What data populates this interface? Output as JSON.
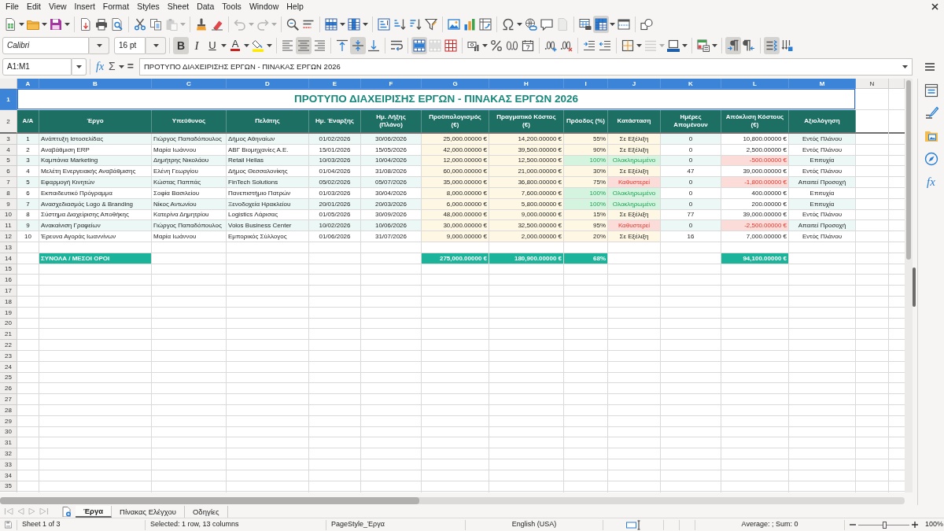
{
  "menu": [
    "File",
    "Edit",
    "View",
    "Insert",
    "Format",
    "Styles",
    "Sheet",
    "Data",
    "Tools",
    "Window",
    "Help"
  ],
  "toolbar_1": [
    [
      {
        "kind": "new",
        "dropdown": true,
        "on": false,
        "disabled": false
      },
      {
        "kind": "open",
        "dropdown": true,
        "on": false,
        "disabled": false
      },
      {
        "kind": "save",
        "dropdown": true,
        "on": false,
        "disabled": false
      }
    ],
    [
      {
        "kind": "pdf",
        "dropdown": false,
        "on": false,
        "disabled": false
      },
      {
        "kind": "print",
        "dropdown": false,
        "on": false,
        "disabled": false
      },
      {
        "kind": "preview",
        "dropdown": false,
        "on": false,
        "disabled": false
      }
    ],
    [
      {
        "kind": "cut",
        "dropdown": false,
        "on": false,
        "disabled": false
      },
      {
        "kind": "copy",
        "dropdown": false,
        "on": false,
        "disabled": false
      },
      {
        "kind": "paste",
        "dropdown": true,
        "on": false,
        "disabled": true
      }
    ],
    [
      {
        "kind": "clone",
        "dropdown": false,
        "on": false,
        "disabled": false
      },
      {
        "kind": "clear",
        "dropdown": false,
        "on": false,
        "disabled": false
      }
    ],
    [
      {
        "kind": "undo",
        "dropdown": true,
        "on": false,
        "disabled": true
      },
      {
        "kind": "redo",
        "dropdown": true,
        "on": false,
        "disabled": true
      }
    ],
    [
      {
        "kind": "find",
        "dropdown": false,
        "on": false,
        "disabled": false
      },
      {
        "kind": "spelling",
        "dropdown": false,
        "on": false,
        "disabled": false
      }
    ],
    [
      {
        "kind": "rows",
        "dropdown": true,
        "on": false,
        "disabled": false
      },
      {
        "kind": "columns",
        "dropdown": true,
        "on": false,
        "disabled": false
      }
    ],
    [
      {
        "kind": "sort",
        "dropdown": false,
        "on": false,
        "disabled": false
      },
      {
        "kind": "sort_asc",
        "dropdown": false,
        "on": false,
        "disabled": false
      },
      {
        "kind": "sort_desc",
        "dropdown": false,
        "on": false,
        "disabled": false
      },
      {
        "kind": "filter",
        "dropdown": false,
        "on": false,
        "disabled": false
      }
    ],
    [
      {
        "kind": "image",
        "dropdown": false,
        "on": false,
        "disabled": false
      },
      {
        "kind": "chart",
        "dropdown": false,
        "on": false,
        "disabled": false
      },
      {
        "kind": "pivot",
        "dropdown": false,
        "on": false,
        "disabled": false
      }
    ],
    [
      {
        "kind": "special",
        "dropdown": true,
        "on": false,
        "disabled": false
      },
      {
        "kind": "hyperlink",
        "dropdown": false,
        "on": false,
        "disabled": false
      },
      {
        "kind": "comment",
        "dropdown": false,
        "on": false,
        "disabled": false
      },
      {
        "kind": "header_footer",
        "dropdown": false,
        "on": false,
        "disabled": true
      }
    ],
    [
      {
        "kind": "print_area",
        "dropdown": false,
        "on": false,
        "disabled": false
      },
      {
        "kind": "freeze",
        "dropdown": true,
        "on": true,
        "disabled": false
      },
      {
        "kind": "split",
        "dropdown": false,
        "on": false,
        "disabled": false
      }
    ],
    [
      {
        "kind": "draw",
        "dropdown": false,
        "on": false,
        "disabled": false
      }
    ]
  ],
  "font": {
    "name": "Calibri",
    "size": "16 pt"
  },
  "toolbar_2": [
    [
      {
        "kind": "bold",
        "glyph": "B",
        "dropdown": false,
        "on": true,
        "disabled": false
      },
      {
        "kind": "italic",
        "glyph": "I",
        "dropdown": false,
        "on": false,
        "disabled": false
      },
      {
        "kind": "underline",
        "glyph": "U",
        "dropdown": true,
        "on": false,
        "disabled": false
      },
      {
        "kind": "font_color",
        "glyph": "A",
        "dropdown": true,
        "on": false,
        "disabled": false
      },
      {
        "kind": "highlight",
        "dropdown": true,
        "on": false,
        "disabled": false
      }
    ],
    [
      {
        "kind": "align_left",
        "dropdown": false,
        "on": false,
        "disabled": false
      },
      {
        "kind": "align_center",
        "dropdown": false,
        "on": true,
        "disabled": false
      },
      {
        "kind": "align_right",
        "dropdown": false,
        "on": false,
        "disabled": false
      }
    ],
    [
      {
        "kind": "align_top",
        "dropdown": false,
        "on": false,
        "disabled": false
      },
      {
        "kind": "align_middle",
        "dropdown": false,
        "on": true,
        "disabled": false
      },
      {
        "kind": "align_bottom",
        "dropdown": false,
        "on": false,
        "disabled": false
      }
    ],
    [
      {
        "kind": "wrap",
        "dropdown": false,
        "on": false,
        "disabled": false
      }
    ],
    [
      {
        "kind": "merge_center",
        "dropdown": false,
        "on": true,
        "disabled": false
      },
      {
        "kind": "merge",
        "dropdown": false,
        "on": false,
        "disabled": true
      },
      {
        "kind": "unmerge",
        "dropdown": false,
        "on": false,
        "disabled": false
      }
    ],
    [
      {
        "kind": "currency",
        "dropdown": true,
        "on": false,
        "disabled": false
      },
      {
        "kind": "percent",
        "dropdown": false,
        "on": false,
        "disabled": false
      },
      {
        "kind": "number",
        "dropdown": false,
        "on": false,
        "disabled": false
      },
      {
        "kind": "date",
        "dropdown": false,
        "on": false,
        "disabled": false
      }
    ],
    [
      {
        "kind": "add_decimal",
        "dropdown": false,
        "on": false,
        "disabled": false
      },
      {
        "kind": "delete_decimal",
        "dropdown": false,
        "on": false,
        "disabled": false
      }
    ],
    [
      {
        "kind": "indent_more",
        "dropdown": false,
        "on": false,
        "disabled": false
      },
      {
        "kind": "indent_less",
        "dropdown": false,
        "on": false,
        "disabled": false
      }
    ],
    [
      {
        "kind": "borders",
        "dropdown": true,
        "on": false,
        "disabled": false
      },
      {
        "kind": "border_style",
        "dropdown": true,
        "on": false,
        "disabled": true
      },
      {
        "kind": "border_color",
        "dropdown": true,
        "on": false,
        "disabled": false
      }
    ],
    [
      {
        "kind": "conditional",
        "dropdown": true,
        "on": false,
        "disabled": false
      }
    ],
    [
      {
        "kind": "ltr",
        "dropdown": false,
        "on": true,
        "disabled": false
      },
      {
        "kind": "rtl",
        "dropdown": false,
        "on": false,
        "disabled": false
      }
    ],
    [
      {
        "kind": "text_ltr",
        "dropdown": false,
        "on": true,
        "disabled": false
      },
      {
        "kind": "text_ttb",
        "dropdown": false,
        "on": false,
        "disabled": false
      }
    ]
  ],
  "formula_bar": {
    "name_box": "A1:M1",
    "function_wizard": "fx",
    "sum": "Σ",
    "formula": "=",
    "content": "ΠΡΟΤΥΠΟ ΔΙΑΧΕΙΡΙΣΗΣ ΕΡΓΩΝ - ΠΙΝΑΚΑΣ ΕΡΓΩΝ 2026"
  },
  "sheet": {
    "columns": [
      {
        "letter": "A",
        "selected": true
      },
      {
        "letter": "B",
        "selected": true
      },
      {
        "letter": "C",
        "selected": true
      },
      {
        "letter": "D",
        "selected": true
      },
      {
        "letter": "E",
        "selected": true
      },
      {
        "letter": "F",
        "selected": true
      },
      {
        "letter": "G",
        "selected": true
      },
      {
        "letter": "H",
        "selected": true
      },
      {
        "letter": "I",
        "selected": true
      },
      {
        "letter": "J",
        "selected": true
      },
      {
        "letter": "K",
        "selected": true
      },
      {
        "letter": "L",
        "selected": true
      },
      {
        "letter": "M",
        "selected": true
      },
      {
        "letter": "N",
        "selected": false
      }
    ],
    "row_numbers": [
      {
        "label": "1",
        "selected": true
      },
      {
        "label": "2",
        "selected": false
      },
      {
        "label": "3",
        "selected": false
      },
      {
        "label": "4",
        "selected": false
      },
      {
        "label": "5",
        "selected": false
      },
      {
        "label": "6",
        "selected": false
      },
      {
        "label": "7",
        "selected": false
      },
      {
        "label": "8",
        "selected": false
      },
      {
        "label": "9",
        "selected": false
      },
      {
        "label": "10",
        "selected": false
      },
      {
        "label": "11",
        "selected": false
      },
      {
        "label": "12",
        "selected": false
      },
      {
        "label": "13",
        "selected": false
      },
      {
        "label": "14",
        "selected": false
      },
      {
        "label": "15",
        "selected": false
      },
      {
        "label": "16",
        "selected": false
      },
      {
        "label": "17",
        "selected": false
      },
      {
        "label": "18",
        "selected": false
      },
      {
        "label": "19",
        "selected": false
      },
      {
        "label": "20",
        "selected": false
      },
      {
        "label": "21",
        "selected": false
      },
      {
        "label": "22",
        "selected": false
      },
      {
        "label": "23",
        "selected": false
      },
      {
        "label": "24",
        "selected": false
      },
      {
        "label": "25",
        "selected": false
      },
      {
        "label": "26",
        "selected": false
      },
      {
        "label": "27",
        "selected": false
      },
      {
        "label": "28",
        "selected": false
      },
      {
        "label": "29",
        "selected": false
      },
      {
        "label": "30",
        "selected": false
      },
      {
        "label": "31",
        "selected": false
      },
      {
        "label": "32",
        "selected": false
      },
      {
        "label": "33",
        "selected": false
      },
      {
        "label": "34",
        "selected": false
      },
      {
        "label": "35",
        "selected": false
      }
    ],
    "title": "ΠΡΟΤΥΠΟ ΔΙΑΧΕΙΡΙΣΗΣ ΕΡΓΩΝ - ΠΙΝΑΚΑΣ ΕΡΓΩΝ 2026",
    "headers": [
      "Α/Α",
      "Έργο",
      "Υπεύθυνος",
      "Πελάτης",
      "Ημ. Έναρξης",
      "Ημ. Λήξης\n(Πλάνο)",
      "Προϋπολογισμός\n(€)",
      "Πραγματικό Κόστος\n(€)",
      "Πρόοδος (%)",
      "Κατάσταση",
      "Ημέρες\nΑπομένουν",
      "Απόκλιση Κόστους\n(€)",
      "Αξιολόγηση"
    ],
    "rows": [
      {
        "cells": [
          "1",
          "Ανάπτυξη Ιστοσελίδας",
          "Γιώργος Παπαδόπουλος",
          "Δήμος Αθηναίων",
          "01/02/2026",
          "30/06/2026",
          "25,000.00000 €",
          "14,200.00000 €",
          "55%",
          "Σε Εξέλιξη",
          "0",
          "10,800.00000 €",
          "Εντός Πλάνου"
        ],
        "kind": "in_progress",
        "overrun": false
      },
      {
        "cells": [
          "2",
          "Αναβάθμιση ERP",
          "Μαρία Ιωάννου",
          "ΑΒΓ Βιομηχανίες Α.Ε.",
          "15/01/2026",
          "15/05/2026",
          "42,000.00000 €",
          "39,500.00000 €",
          "90%",
          "Σε Εξέλιξη",
          "0",
          "2,500.00000 €",
          "Εντός Πλάνου"
        ],
        "kind": "in_progress",
        "overrun": false
      },
      {
        "cells": [
          "3",
          "Καμπάνια Marketing",
          "Δημήτρης Νικολάου",
          "Retail Hellas",
          "10/03/2026",
          "10/04/2026",
          "12,000.00000 €",
          "12,500.00000 €",
          "100%",
          "Ολοκληρωμένο",
          "0",
          "-500.00000 €",
          "Επιτυχία"
        ],
        "kind": "done",
        "overrun": true
      },
      {
        "cells": [
          "4",
          "Μελέτη Ενεργειακής Αναβάθμισης",
          "Ελένη Γεωργίου",
          "Δήμος Θεσσαλονίκης",
          "01/04/2026",
          "31/08/2026",
          "60,000.00000 €",
          "21,000.00000 €",
          "30%",
          "Σε Εξέλιξη",
          "47",
          "39,000.00000 €",
          "Εντός Πλάνου"
        ],
        "kind": "in_progress",
        "overrun": false
      },
      {
        "cells": [
          "5",
          "Εφαρμογή Κινητών",
          "Κώστας Παππάς",
          "FinTech Solutions",
          "05/02/2026",
          "05/07/2026",
          "35,000.00000 €",
          "36,800.00000 €",
          "75%",
          "Καθυστερεί",
          "0",
          "-1,800.00000 €",
          "Απαιτεί Προσοχή"
        ],
        "kind": "delayed",
        "overrun": true
      },
      {
        "cells": [
          "6",
          "Εκπαιδευτικό Πρόγραμμα",
          "Σοφία Βασιλείου",
          "Πανεπιστήμιο Πατρών",
          "01/03/2026",
          "30/04/2026",
          "8,000.00000 €",
          "7,600.00000 €",
          "100%",
          "Ολοκληρωμένο",
          "0",
          "400.00000 €",
          "Επιτυχία"
        ],
        "kind": "done",
        "overrun": false
      },
      {
        "cells": [
          "7",
          "Ανασχεδιασμός Logo & Branding",
          "Νίκος Αντωνίου",
          "Ξενοδοχεία Ηρακλείου",
          "20/01/2026",
          "20/03/2026",
          "6,000.00000 €",
          "5,800.00000 €",
          "100%",
          "Ολοκληρωμένο",
          "0",
          "200.00000 €",
          "Επιτυχία"
        ],
        "kind": "done",
        "overrun": false
      },
      {
        "cells": [
          "8",
          "Σύστημα Διαχείρισης Αποθήκης",
          "Κατερίνα Δημητρίου",
          "Logistics Λάρισας",
          "01/05/2026",
          "30/09/2026",
          "48,000.00000 €",
          "9,000.00000 €",
          "15%",
          "Σε Εξέλιξη",
          "77",
          "39,000.00000 €",
          "Εντός Πλάνου"
        ],
        "kind": "in_progress",
        "overrun": false
      },
      {
        "cells": [
          "9",
          "Ανακαίνιση Γραφείων",
          "Γιώργος Παπαδόπουλος",
          "Volos Business Center",
          "10/02/2026",
          "10/06/2026",
          "30,000.00000 €",
          "32,500.00000 €",
          "95%",
          "Καθυστερεί",
          "0",
          "-2,500.00000 €",
          "Απαιτεί Προσοχή"
        ],
        "kind": "delayed",
        "overrun": true
      },
      {
        "cells": [
          "10",
          "Έρευνα Αγοράς Ιωαννίνων",
          "Μαρία Ιωάννου",
          "Εμπορικός Σύλλογος",
          "01/06/2026",
          "31/07/2026",
          "9,000.00000 €",
          "2,000.00000 €",
          "20%",
          "Σε Εξέλιξη",
          "16",
          "7,000.00000 €",
          "Εντός Πλάνου"
        ],
        "kind": "in_progress",
        "overrun": false
      }
    ],
    "totals": {
      "label": "ΣΥΝΟΛΑ / ΜΕΣΟΙ ΟΡΟΙ",
      "budget": "275,000.00000 €",
      "actual": "180,900.00000 €",
      "progress": "68%",
      "deviation": "94,100.00000 €"
    }
  },
  "sidebar_tabs": [
    {
      "kind": "properties",
      "selected": false
    },
    {
      "kind": "styles",
      "selected": false
    },
    {
      "kind": "gallery",
      "selected": false
    },
    {
      "kind": "navigator",
      "selected": false
    },
    {
      "kind": "functions",
      "glyph": "fx",
      "selected": false
    }
  ],
  "sheet_nav": [
    {
      "kind": "first",
      "disabled": true
    },
    {
      "kind": "previous",
      "disabled": true
    },
    {
      "kind": "next",
      "disabled": true
    },
    {
      "kind": "last",
      "disabled": true
    }
  ],
  "sheet_tabs": [
    {
      "label": "Έργα",
      "selected": true
    },
    {
      "label": "Πίνακας Ελέγχου",
      "selected": false
    },
    {
      "label": "Οδηγίες",
      "selected": false
    }
  ],
  "status_bar": {
    "sheet": "Sheet 1 of 3",
    "selection": "Selected: 1 row, 13 columns",
    "page_style": "PageStyle_Έργα",
    "language": "English (USA)",
    "summary": "Average: ; Sum: 0",
    "zoom": "100%",
    "zoom_slider": {
      "level": 0.5
    }
  }
}
